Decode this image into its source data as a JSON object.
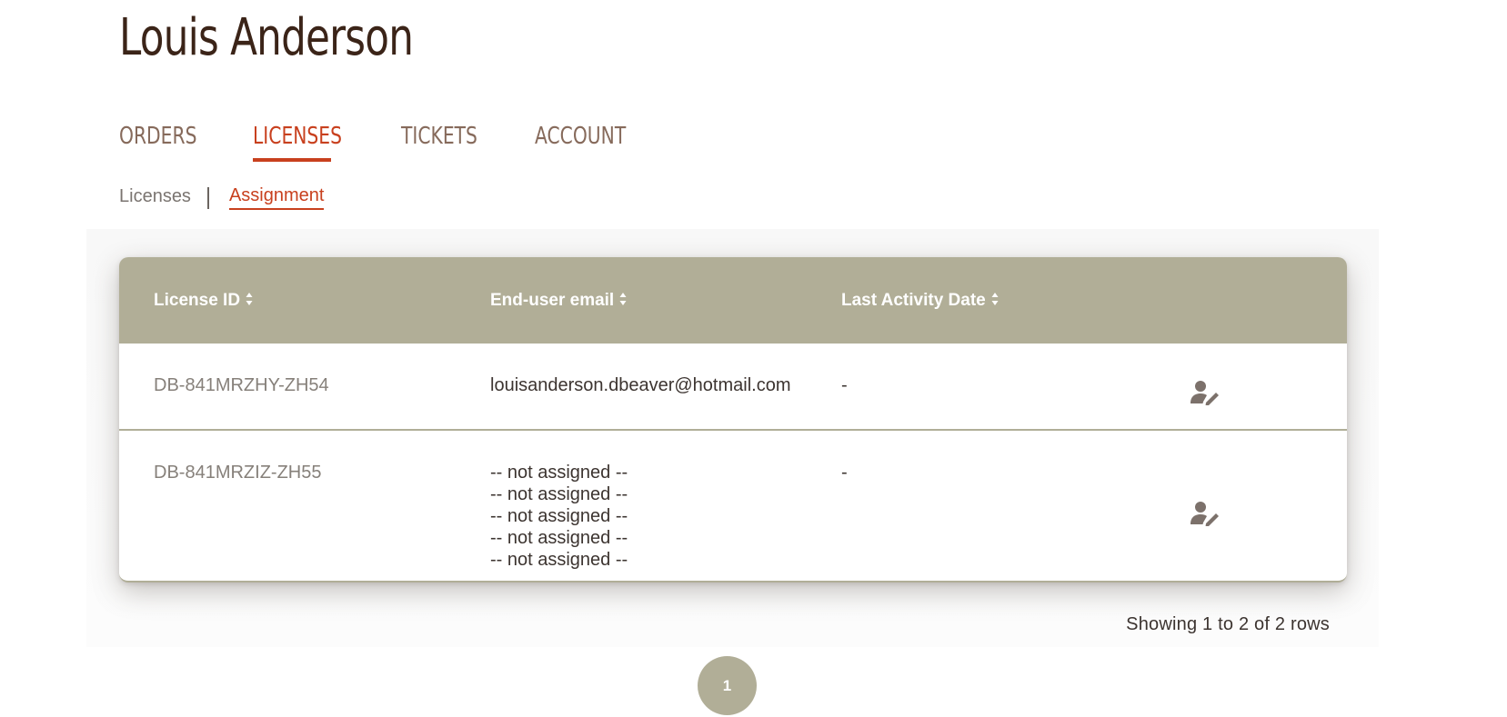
{
  "header": {
    "title": "Louis Anderson"
  },
  "tabs": [
    {
      "label": "ORDERS",
      "active": false
    },
    {
      "label": "LICENSES",
      "active": true
    },
    {
      "label": "TICKETS",
      "active": false
    },
    {
      "label": "ACCOUNT",
      "active": false
    }
  ],
  "subnav": {
    "licenses_label": "Licenses",
    "assignment_label": "Assignment",
    "active": "Assignment"
  },
  "table": {
    "columns": [
      {
        "label": "License ID",
        "sortable": true
      },
      {
        "label": "End-user email",
        "sortable": true
      },
      {
        "label": "Last Activity Date",
        "sortable": true
      }
    ],
    "rows": [
      {
        "license_id": "DB-841MRZHY-ZH54",
        "emails": [
          "louisanderson.dbeaver@hotmail.com"
        ],
        "last_activity": "-",
        "action_icon": "user-edit-icon"
      },
      {
        "license_id": "DB-841MRZIZ-ZH55",
        "emails": [
          "-- not assigned --",
          "-- not assigned --",
          "-- not assigned --",
          "-- not assigned --",
          "-- not assigned --"
        ],
        "last_activity": "-",
        "action_icon": "user-edit-icon"
      }
    ]
  },
  "pagination": {
    "info": "Showing 1 to 2 of 2 rows",
    "current_page": "1"
  },
  "colors": {
    "accent": "#c8401e",
    "header_bg": "#b1ae97",
    "title": "#3b2418",
    "tab_inactive": "#866a5b"
  }
}
